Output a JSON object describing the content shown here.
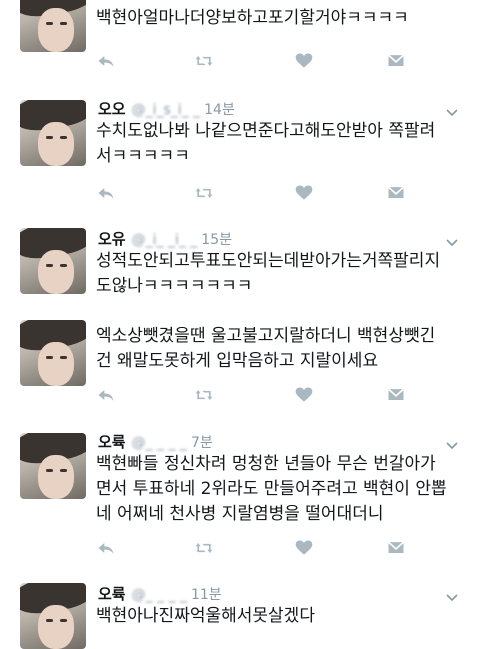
{
  "tweets": [
    {
      "name": "",
      "handle": "",
      "time": "",
      "lines": [
        "백현아얼마나더양보하고포기할거야ㅋㅋㅋㅋ"
      ]
    },
    {
      "name": "오오",
      "handle": "@_i_s_i_ _",
      "time": "14분",
      "lines": [
        "수치도없나봐 나같으면준다고해도안받아 쪽팔려",
        "서ㅋㅋㅋㅋㅋ"
      ]
    },
    {
      "name": "오유",
      "handle": "@_i_ _i_ _",
      "time": "15분",
      "lines": [
        "성적도안되고투표도안되는데받아가는거쪽팔리지",
        "도않나ㅋㅋㅋㅋㅋㅋㅋ"
      ]
    },
    {
      "name": "",
      "handle": "",
      "time": "",
      "lines": [
        "엑소상뺏겼을땐 울고불고지랄하더니 백현상뺏긴",
        "건 왜말도못하게 입막음하고 지랄이세요"
      ]
    },
    {
      "name": "오륙",
      "handle": "@_ _ _ _",
      "time": "7분",
      "lines": [
        "백현빠들 정신차려 멍청한 년들아 무슨 번갈아가",
        "면서 투표하네 2위라도 만들어주려고 백현이 안뽑",
        "네 어쩌네 천사병 지랄염병을 떨어대더니"
      ]
    },
    {
      "name": "오륙",
      "handle": "@_ _ _ _",
      "time": "11분",
      "lines": [
        "백현아나진짜억울해서못살겠다"
      ]
    }
  ],
  "icons": {
    "reply": "reply-icon",
    "retweet": "retweet-icon",
    "like": "heart-icon",
    "dm": "envelope-icon",
    "caret": "chevron-down-icon"
  },
  "colors": {
    "icon": "#aab8c2",
    "meta": "#8899a6",
    "divider": "#e1e8ed"
  }
}
